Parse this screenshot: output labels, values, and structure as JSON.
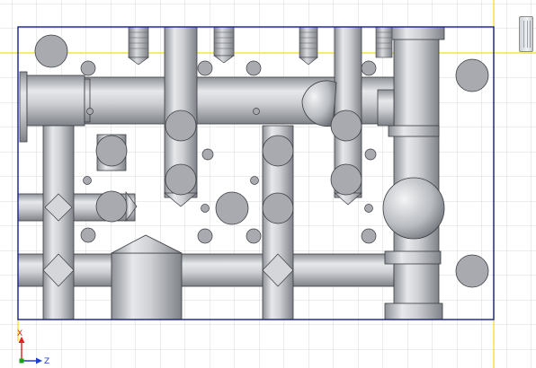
{
  "viewport": {
    "background": "#ffffff",
    "grid_color": "#d8d8d8",
    "highlight_line_color": "#f2e01d",
    "sketch_border_color": "#141e8c"
  },
  "triad": {
    "x_label": "X",
    "z_label": "Z",
    "x_color": "#e02020",
    "z_color": "#1f3fd0",
    "origin_color": "#1aa01a"
  },
  "view_cube": {
    "icon": "view-cube-icon"
  },
  "part": {
    "body_color": "#b9bcc1",
    "edge_color": "#3a3d42",
    "hole_color": "#a8aab0"
  }
}
